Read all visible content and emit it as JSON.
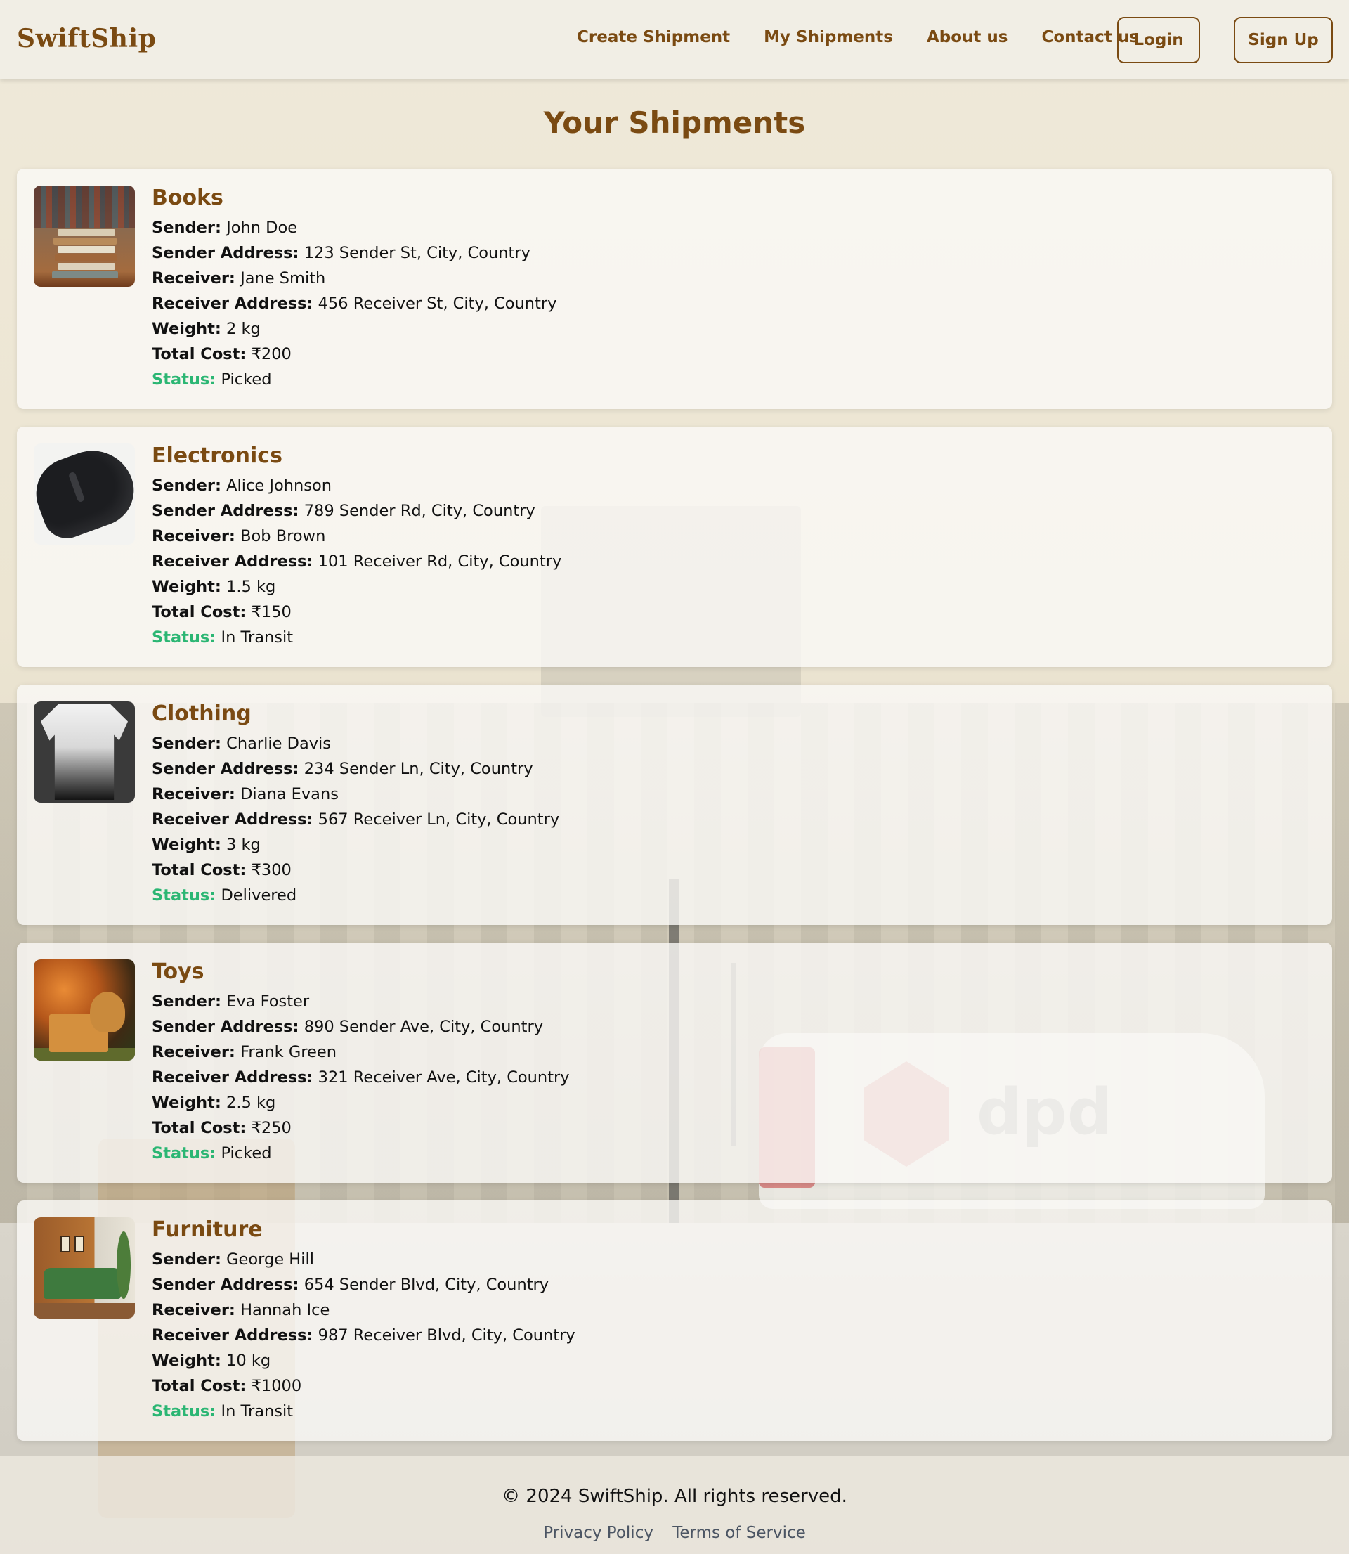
{
  "header": {
    "brand": "SwiftShip",
    "nav": [
      "Create Shipment",
      "My Shipments",
      "About us",
      "Contact us"
    ],
    "login_label": "Login",
    "signup_label": "Sign Up"
  },
  "page": {
    "title": "Your Shipments"
  },
  "labels": {
    "sender": "Sender:",
    "sender_address": "Sender Address:",
    "receiver": "Receiver:",
    "receiver_address": "Receiver Address:",
    "weight": "Weight:",
    "total_cost": "Total Cost:",
    "status": "Status:"
  },
  "shipments": [
    {
      "title": "Books",
      "sender": "John Doe",
      "sender_address": "123 Sender St, City, Country",
      "receiver": "Jane Smith",
      "receiver_address": "456 Receiver St, City, Country",
      "weight": "2 kg",
      "total_cost": "₹200",
      "status": "Picked",
      "image": "books-stack"
    },
    {
      "title": "Electronics",
      "sender": "Alice Johnson",
      "sender_address": "789 Sender Rd, City, Country",
      "receiver": "Bob Brown",
      "receiver_address": "101 Receiver Rd, City, Country",
      "weight": "1.5 kg",
      "total_cost": "₹150",
      "status": "In Transit",
      "image": "computer-mouse"
    },
    {
      "title": "Clothing",
      "sender": "Charlie Davis",
      "sender_address": "234 Sender Ln, City, Country",
      "receiver": "Diana Evans",
      "receiver_address": "567 Receiver Ln, City, Country",
      "weight": "3 kg",
      "total_cost": "₹300",
      "status": "Delivered",
      "image": "shirt"
    },
    {
      "title": "Toys",
      "sender": "Eva Foster",
      "sender_address": "890 Sender Ave, City, Country",
      "receiver": "Frank Green",
      "receiver_address": "321 Receiver Ave, City, Country",
      "weight": "2.5 kg",
      "total_cost": "₹250",
      "status": "Picked",
      "image": "teddy-bear"
    },
    {
      "title": "Furniture",
      "sender": "George Hill",
      "sender_address": "654 Sender Blvd, City, Country",
      "receiver": "Hannah Ice",
      "receiver_address": "987 Receiver Blvd, City, Country",
      "weight": "10 kg",
      "total_cost": "₹1000",
      "status": "In Transit",
      "image": "green-sofa"
    }
  ],
  "footer": {
    "copyright": "© 2024 SwiftShip. All rights reserved.",
    "links": [
      "Privacy Policy",
      "Terms of Service"
    ]
  },
  "colors": {
    "brand": "#7a4a12",
    "status": "#2bb673",
    "header_bg": "#f1eee5"
  }
}
